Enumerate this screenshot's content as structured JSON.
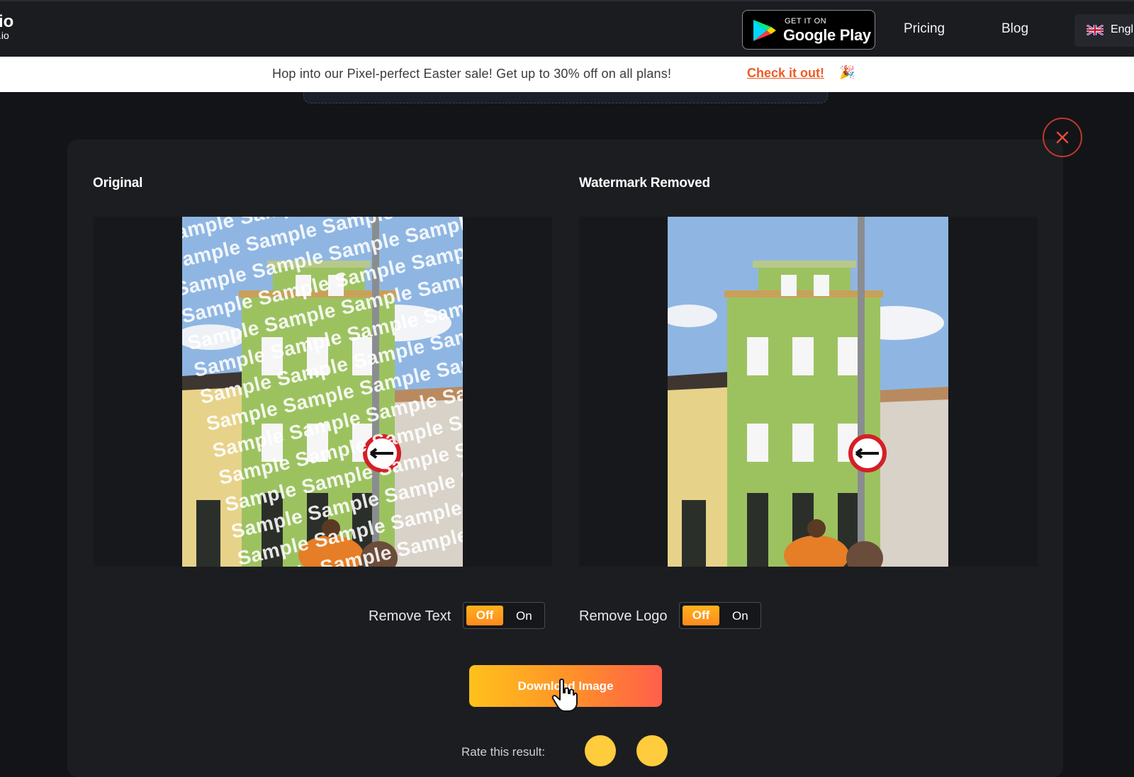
{
  "header": {
    "logo_main": "io",
    "logo_sub": ".io",
    "store_badge": {
      "small": "GET IT ON",
      "big": "Google Play"
    },
    "nav": [
      "Pricing",
      "Blog"
    ],
    "language": "Engl"
  },
  "promo": {
    "message": "Hop into our Pixel-perfect Easter sale! Get up to 30% off on all plans!",
    "cta": "Check it out!",
    "party_icon": "🎉"
  },
  "panel": {
    "original_title": "Original",
    "removed_title": "Watermark Removed",
    "watermark_word": "Sample"
  },
  "controls": {
    "remove_text": {
      "label": "Remove Text",
      "off": "Off",
      "on": "On",
      "state": "off"
    },
    "remove_logo": {
      "label": "Remove Logo",
      "off": "Off",
      "on": "On",
      "state": "off"
    },
    "download_label": "Download Image",
    "rate_label": "Rate this result:"
  },
  "colors": {
    "accent_orange": "#ff8a1f",
    "close_red": "#c0392b",
    "cta_orange": "#ee5a24"
  }
}
